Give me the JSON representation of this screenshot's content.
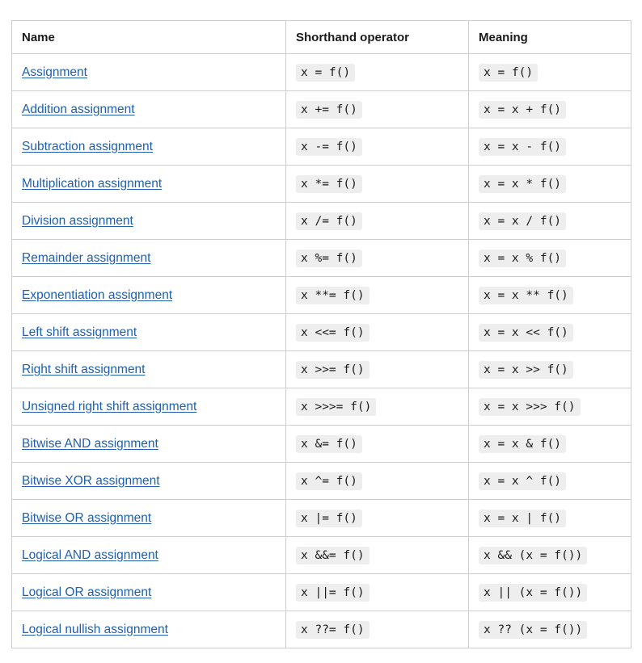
{
  "table": {
    "headers": [
      "Name",
      "Shorthand operator",
      "Meaning"
    ],
    "rows": [
      {
        "name": "Assignment",
        "shorthand": "x = f()",
        "meaning": "x = f()"
      },
      {
        "name": "Addition assignment",
        "shorthand": "x += f()",
        "meaning": "x = x + f()"
      },
      {
        "name": "Subtraction assignment",
        "shorthand": "x -= f()",
        "meaning": "x = x - f()"
      },
      {
        "name": "Multiplication assignment",
        "shorthand": "x *= f()",
        "meaning": "x = x * f()"
      },
      {
        "name": "Division assignment",
        "shorthand": "x /= f()",
        "meaning": "x = x / f()"
      },
      {
        "name": "Remainder assignment",
        "shorthand": "x %= f()",
        "meaning": "x = x % f()"
      },
      {
        "name": "Exponentiation assignment",
        "shorthand": "x **= f()",
        "meaning": "x = x ** f()"
      },
      {
        "name": "Left shift assignment",
        "shorthand": "x <<= f()",
        "meaning": "x = x << f()"
      },
      {
        "name": "Right shift assignment",
        "shorthand": "x >>= f()",
        "meaning": "x = x >> f()"
      },
      {
        "name": "Unsigned right shift assignment",
        "shorthand": "x >>>= f()",
        "meaning": "x = x >>> f()"
      },
      {
        "name": "Bitwise AND assignment",
        "shorthand": "x &= f()",
        "meaning": "x = x & f()"
      },
      {
        "name": "Bitwise XOR assignment",
        "shorthand": "x ^= f()",
        "meaning": "x = x ^ f()"
      },
      {
        "name": "Bitwise OR assignment",
        "shorthand": "x |= f()",
        "meaning": "x = x | f()"
      },
      {
        "name": "Logical AND assignment",
        "shorthand": "x &&= f()",
        "meaning": "x && (x = f())"
      },
      {
        "name": "Logical OR assignment",
        "shorthand": "x ||= f()",
        "meaning": "x || (x = f())"
      },
      {
        "name": "Logical nullish assignment",
        "shorthand": "x ??= f()",
        "meaning": "x ?? (x = f())"
      }
    ]
  },
  "colors": {
    "link": "#1d5fb0",
    "border": "#cdcdcd",
    "code_bg": "#eeeeee",
    "text": "#1b1b1b"
  }
}
